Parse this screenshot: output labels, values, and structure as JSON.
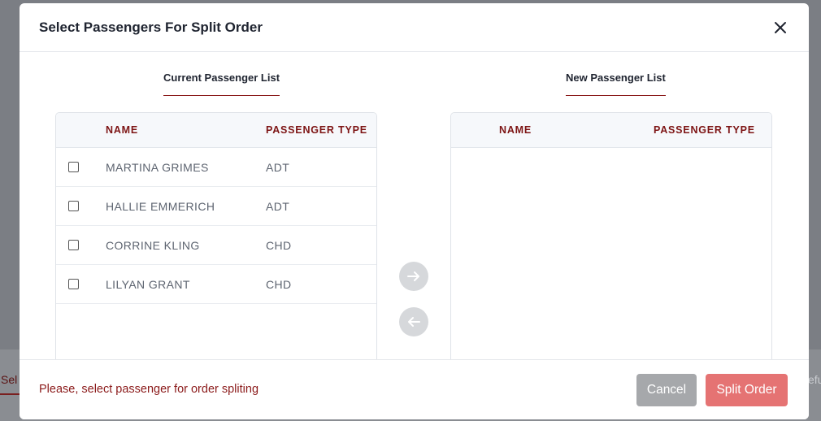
{
  "background": {
    "left_text": "Sel",
    "right_text": "efu"
  },
  "modal": {
    "title": "Select Passengers For Split Order",
    "close_icon": "close-icon"
  },
  "current_list": {
    "heading": "Current Passenger List",
    "columns": [
      "NAME",
      "PASSENGER TYPE"
    ],
    "rows": [
      {
        "name": "MARTINA GRIMES",
        "type": "ADT"
      },
      {
        "name": "HALLIE EMMERICH",
        "type": "ADT"
      },
      {
        "name": "CORRINE KLING",
        "type": "CHD"
      },
      {
        "name": "LILYAN GRANT",
        "type": "CHD"
      }
    ]
  },
  "new_list": {
    "heading": "New Passenger List",
    "columns": [
      "NAME",
      "PASSENGER TYPE"
    ],
    "rows": []
  },
  "transfer": {
    "move_right_icon": "arrow-right-icon",
    "move_left_icon": "arrow-left-icon"
  },
  "footer": {
    "message": "Please, select passenger for order spliting",
    "cancel_label": "Cancel",
    "split_label": "Split Order"
  },
  "colors": {
    "accent": "#8b1a1a",
    "split_button": "#e57373",
    "cancel_button": "#a6a8ab"
  }
}
